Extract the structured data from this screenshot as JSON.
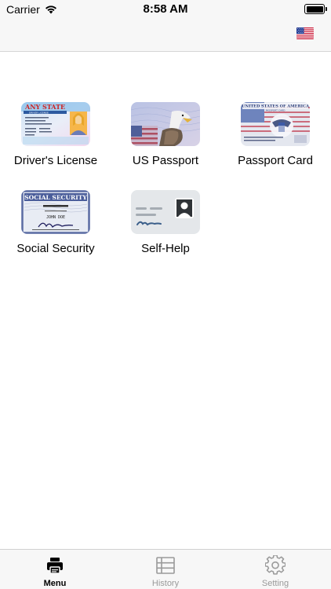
{
  "status_bar": {
    "carrier": "Carrier",
    "time": "8:58 AM",
    "wifi_icon": "wifi-icon",
    "battery_icon": "battery-icon"
  },
  "nav_bar": {
    "flag_icon": "us-flag-icon"
  },
  "menu": {
    "items": [
      {
        "label": "Driver's License",
        "icon": "drivers-license-card-image"
      },
      {
        "label": "US Passport",
        "icon": "us-passport-image"
      },
      {
        "label": "Passport Card",
        "icon": "passport-card-image"
      },
      {
        "label": "Social Security",
        "icon": "social-security-card-image"
      },
      {
        "label": "Self-Help",
        "icon": "generic-id-card-icon"
      }
    ],
    "thumbnail_text": {
      "license_state": "ANY STATE",
      "license_sub": "DRIVER LICENSE",
      "passport_card_title": "UNITED STATES OF AMERICA",
      "passport_card_sub": "PASSPORT CARD",
      "ssn_title": "SOCIAL SECURITY",
      "ssn_name": "JOHN DOE"
    }
  },
  "tab_bar": {
    "tabs": [
      {
        "label": "Menu",
        "icon": "printer-icon",
        "active": true
      },
      {
        "label": "History",
        "icon": "list-icon",
        "active": false
      },
      {
        "label": "Setting",
        "icon": "gear-icon",
        "active": false
      }
    ]
  },
  "colors": {
    "active_tab": "#000000",
    "inactive_tab": "#9a9a9a",
    "bar_background": "#f7f7f7"
  }
}
